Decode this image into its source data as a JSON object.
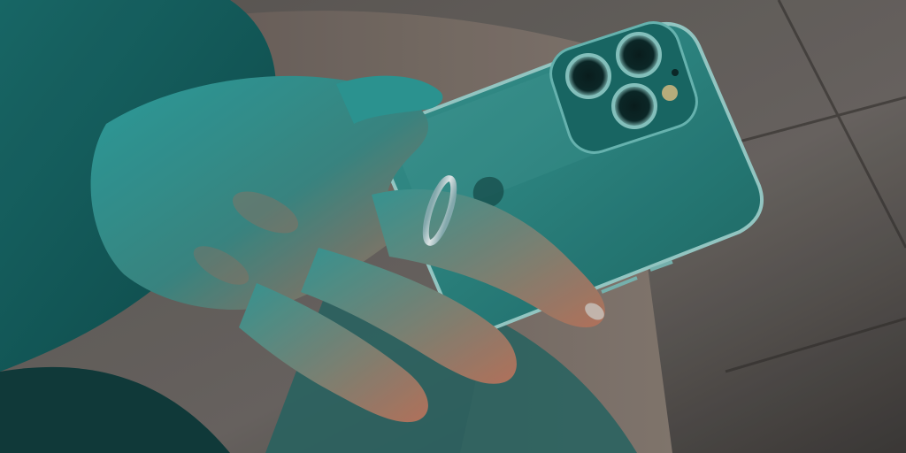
{
  "scene": {
    "subject": "hand-holding-phone",
    "colors": {
      "floor": "#6f6a66",
      "floor_dark": "#3f3c3a",
      "tile_line": "#2f2c2a",
      "sleeve": "#1f7876",
      "sleeve_shadow": "#0f4f4f",
      "pants": "#7a6f68",
      "pants_dark": "#4a4541",
      "skin_lit": "#2ea7a6",
      "skin_warm": "#b8725e",
      "skin_shadow": "#3a4b4b",
      "phone_body": "#2f8c88",
      "phone_highlight": "#5bb3ae",
      "phone_edge": "#9fd6d2",
      "camera_bump": "#1b6e6b",
      "lens": "#0d2b2b",
      "lens_ring": "#8fd0cb",
      "ring": "#d6e6ea"
    }
  }
}
